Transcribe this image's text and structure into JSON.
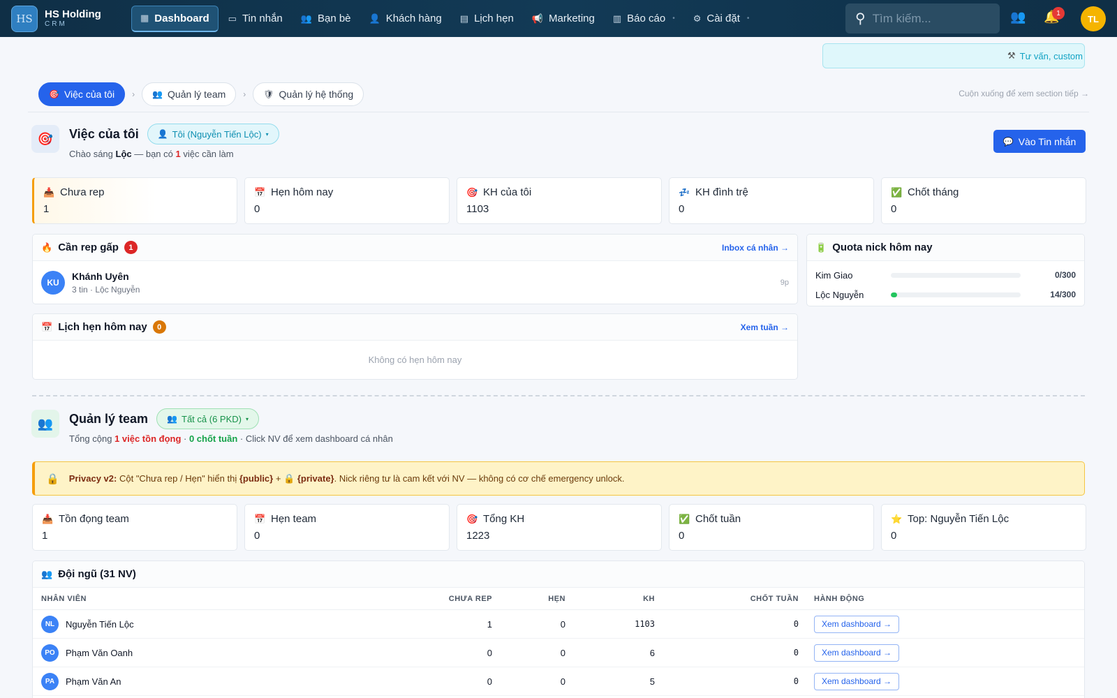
{
  "brand": {
    "logo": "HS",
    "name": "HS Holding",
    "sub": "CRM"
  },
  "nav": [
    {
      "icon": "dashboard-icon",
      "glyph": "▦",
      "label": "Dashboard",
      "active": true
    },
    {
      "icon": "message-icon",
      "glyph": "▭",
      "label": "Tin nhắn"
    },
    {
      "icon": "friends-icon",
      "glyph": "👥",
      "label": "Bạn bè"
    },
    {
      "icon": "customer-icon",
      "glyph": "👤",
      "label": "Khách hàng"
    },
    {
      "icon": "calendar-icon",
      "glyph": "▤",
      "label": "Lịch hẹn"
    },
    {
      "icon": "megaphone-icon",
      "glyph": "📢",
      "label": "Marketing"
    },
    {
      "icon": "report-icon",
      "glyph": "▥",
      "label": "Báo cáo"
    },
    {
      "icon": "gear-icon",
      "glyph": "⚙",
      "label": "Cài đặt"
    }
  ],
  "search": {
    "placeholder": "Tìm kiếm..."
  },
  "notifications": {
    "count": "1"
  },
  "user": {
    "initials": "TL"
  },
  "ticker": {
    "text": "Tư vấn, custom"
  },
  "section_pills": [
    {
      "label": "Việc của tôi",
      "glyph": "🎯",
      "active": true
    },
    {
      "label": "Quản lý team",
      "glyph": "👥"
    },
    {
      "label": "Quản lý hệ thống",
      "glyph": "🛡"
    }
  ],
  "scroll_hint": "Cuộn xuống để xem section tiếp →",
  "my_work": {
    "title": "Việc của tôi",
    "scope": "Tôi (Nguyễn Tiến Lộc)",
    "greeting_pre": "Chào sáng ",
    "greeting_name": "Lộc",
    "greeting_mid": " — bạn có ",
    "greeting_count": "1",
    "greeting_post": " việc cần làm",
    "button": "Vào Tin nhắn",
    "stats": [
      {
        "glyph": "📥",
        "label": "Chưa rep",
        "value": "1"
      },
      {
        "glyph": "📅",
        "label": "Hẹn hôm nay",
        "value": "0"
      },
      {
        "glyph": "🎯",
        "label": "KH của tôi",
        "value": "1103"
      },
      {
        "glyph": "💤",
        "label": "KH đình trệ",
        "value": "0"
      },
      {
        "glyph": "✅",
        "label": "Chốt tháng",
        "value": "0"
      }
    ],
    "urgent": {
      "title": "Cần rep gấp",
      "count": "1",
      "link": "Inbox cá nhân →",
      "items": [
        {
          "initials": "KU",
          "name": "Khánh Uyên",
          "meta": "3 tin · Lộc Nguyễn",
          "time": "9p"
        }
      ]
    },
    "appointments": {
      "title": "Lịch hẹn hôm nay",
      "count": "0",
      "link": "Xem tuần →",
      "empty": "Không có hẹn hôm nay"
    },
    "quota": {
      "title": "Quota nick hôm nay",
      "rows": [
        {
          "name": "Kim Giao",
          "value": "0/300",
          "fraction": 0
        },
        {
          "name": "Lộc Nguyễn",
          "value": "14/300",
          "fraction": 0.0467
        }
      ]
    }
  },
  "team": {
    "title": "Quản lý team",
    "scope": "Tất cả (6 PKD)",
    "summary_pre": "Tổng cộng ",
    "summary_backlog": "1 việc tồn đọng",
    "summary_sep": " · ",
    "summary_closed": "0 chốt tuần",
    "summary_post": " · Click NV để xem dashboard cá nhân",
    "privacy": {
      "label": "Privacy v2:",
      "text1": " Cột \"Chưa rep / Hẹn\" hiển thị ",
      "public": "{public}",
      "plus": " + 🔒 ",
      "private": "{private}",
      "text2": ". Nick riêng tư là cam kết với NV — không có cơ chế emergency unlock."
    },
    "stats": [
      {
        "glyph": "📥",
        "label": "Tồn đọng team",
        "value": "1"
      },
      {
        "glyph": "📅",
        "label": "Hẹn team",
        "value": "0"
      },
      {
        "glyph": "🎯",
        "label": "Tổng KH",
        "value": "1223"
      },
      {
        "glyph": "✅",
        "label": "Chốt tuần",
        "value": "0"
      },
      {
        "glyph": "⭐",
        "label": "Top: Nguyễn Tiến Lộc",
        "value": "0"
      }
    ],
    "roster": {
      "title": "Đội ngũ (31 NV)",
      "columns": [
        "NHÂN VIÊN",
        "CHƯA REP",
        "HẸN",
        "KH",
        "CHỐT TUẦN",
        "HÀNH ĐỘNG"
      ],
      "rows": [
        {
          "initials": "NL",
          "name": "Nguyễn Tiến Lộc",
          "chua_rep": "1",
          "hen": "0",
          "kh": "1103",
          "chot": "0",
          "action": "Xem dashboard →"
        },
        {
          "initials": "PO",
          "name": "Phạm Văn Oanh",
          "chua_rep": "0",
          "hen": "0",
          "kh": "6",
          "chot": "0",
          "action": "Xem dashboard →"
        },
        {
          "initials": "PA",
          "name": "Phạm Văn An",
          "chua_rep": "0",
          "hen": "0",
          "kh": "5",
          "chot": "0",
          "action": "Xem dashboard →"
        }
      ]
    }
  }
}
